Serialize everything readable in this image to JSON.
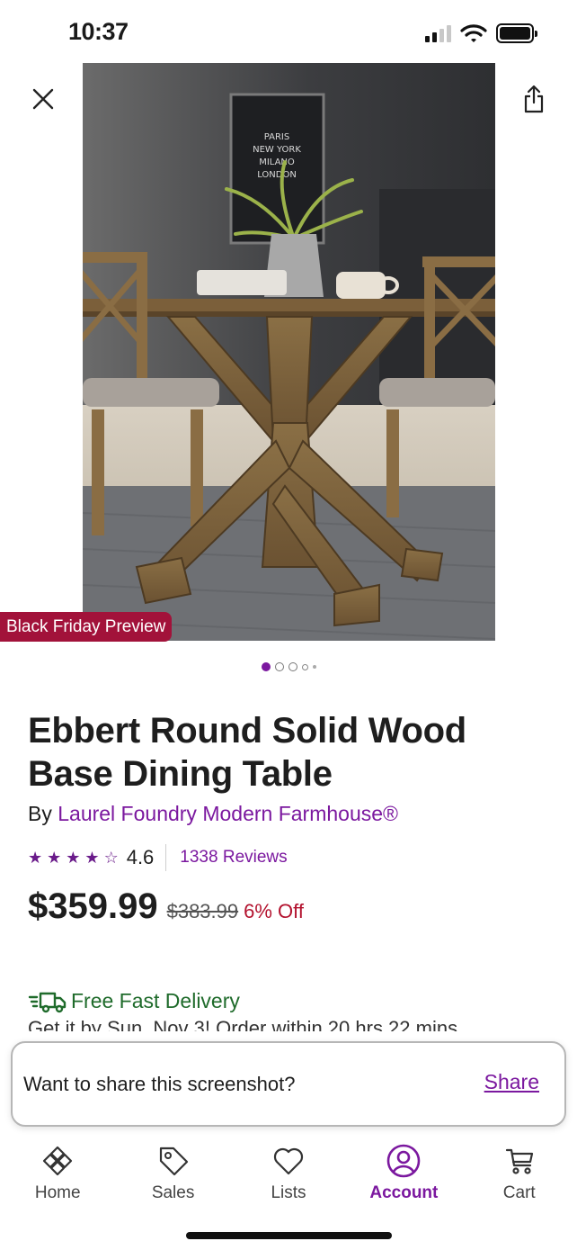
{
  "status_bar": {
    "time": "10:37"
  },
  "hero": {
    "badge": "Black Friday Preview",
    "poster_lines": [
      "PARIS",
      "NEW YORK",
      "MILANO",
      "LONDON"
    ],
    "image_count": 5,
    "active_image": 1
  },
  "product": {
    "title": "Ebbert Round Solid Wood Base Dining Table",
    "by_prefix": "By",
    "brand": "Laurel Foundry Modern Farmhouse®",
    "rating": "4.6",
    "star_rating": 4.6,
    "reviews": "1338 Reviews",
    "price": "$359.99",
    "original_price": "$383.99",
    "discount": "6% Off",
    "delivery_label": "Free Fast Delivery",
    "delivery_detail": "Get it by Sun, Nov 3! Order within 20 hrs 22 mins"
  },
  "share_popup": {
    "question": "Want to share this screenshot?",
    "action": "Share"
  },
  "tab_bar": {
    "tabs": [
      {
        "label": "Home",
        "icon": "home-icon"
      },
      {
        "label": "Sales",
        "icon": "tag-icon"
      },
      {
        "label": "Lists",
        "icon": "heart-icon"
      },
      {
        "label": "Account",
        "icon": "account-icon"
      },
      {
        "label": "Cart",
        "icon": "cart-icon"
      }
    ],
    "active": "Account"
  },
  "colors": {
    "brand_purple": "#7b189f",
    "badge_red": "#a2123a",
    "discount_red": "#b3122e",
    "delivery_green": "#1f6b2b"
  }
}
